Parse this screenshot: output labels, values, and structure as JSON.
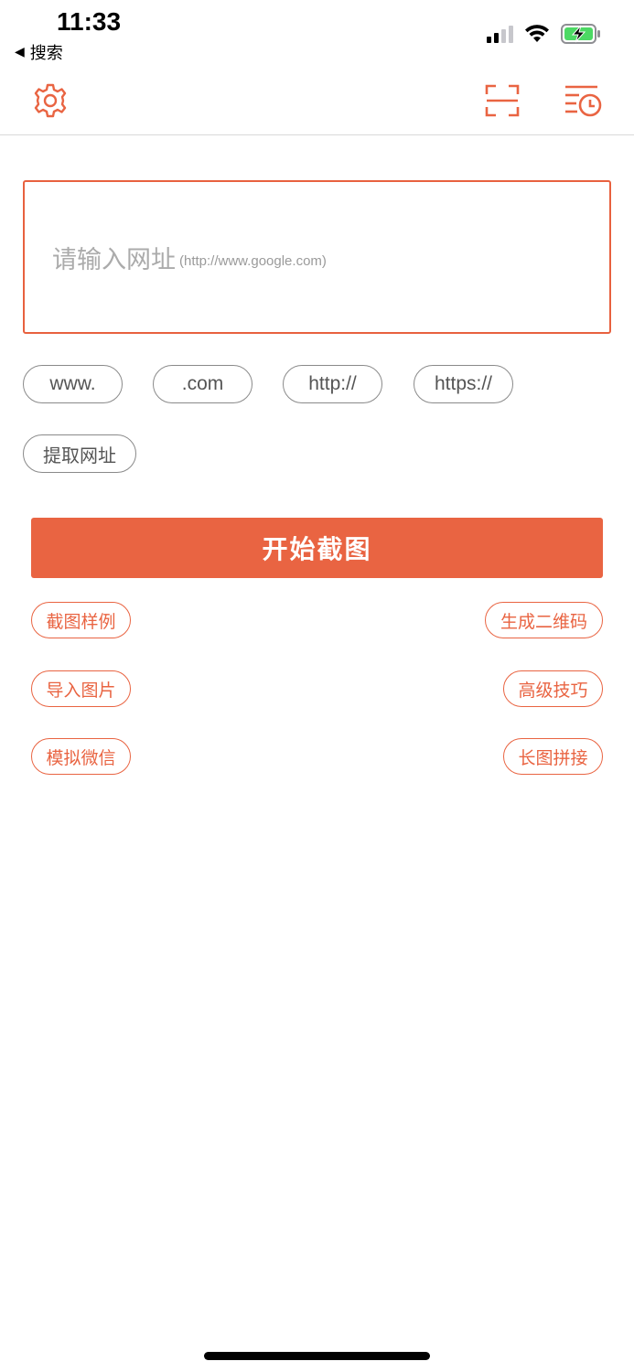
{
  "status_bar": {
    "time": "11:33",
    "back_label": "搜索"
  },
  "nav": {
    "settings_icon": "gear-icon",
    "scan_icon": "scan-icon",
    "history_icon": "history-icon"
  },
  "url_input": {
    "placeholder": "请输入网址",
    "placeholder_hint": "(http://www.google.com)"
  },
  "quick_chips": [
    "www.",
    ".com",
    "http://",
    "https://"
  ],
  "extract_button": "提取网址",
  "start_button": "开始截图",
  "links": {
    "left": [
      "截图样例",
      "导入图片",
      "模拟微信"
    ],
    "right": [
      "生成二维码",
      "高级技巧",
      "长图拼接"
    ]
  },
  "colors": {
    "accent": "#e96442",
    "chip_border": "#8a8a8a"
  }
}
